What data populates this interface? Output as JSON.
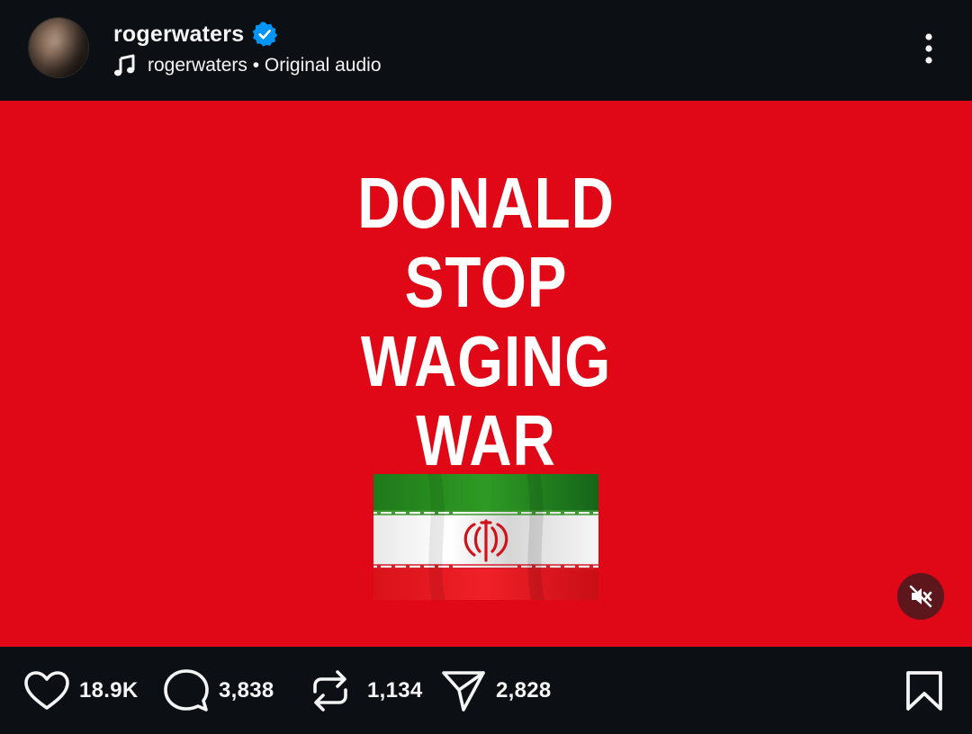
{
  "post": {
    "username": "rogerwaters",
    "verified": true,
    "audio_owner": "rogerwaters",
    "audio_separator": " • ",
    "audio_label": "Original audio"
  },
  "media": {
    "headline_lines": [
      "DONALD",
      "STOP",
      "WAGING",
      "WAR"
    ],
    "background_color": "#e00716",
    "flag": "iran-flag",
    "sound_state": "muted"
  },
  "actions": {
    "likes": "18.9K",
    "comments": "3,838",
    "reposts": "1,134",
    "shares": "2,828"
  },
  "icons": {
    "verified": "verified-badge-icon",
    "music": "music-note-icon",
    "more": "more-options-icon",
    "mute": "speaker-muted-icon",
    "like": "heart-icon",
    "comment": "comment-bubble-icon",
    "repost": "repost-icon",
    "share": "paper-plane-icon",
    "save": "bookmark-icon"
  },
  "colors": {
    "background": "#0c1014",
    "verified_blue": "#0095f6",
    "text": "#f5f5f5"
  }
}
